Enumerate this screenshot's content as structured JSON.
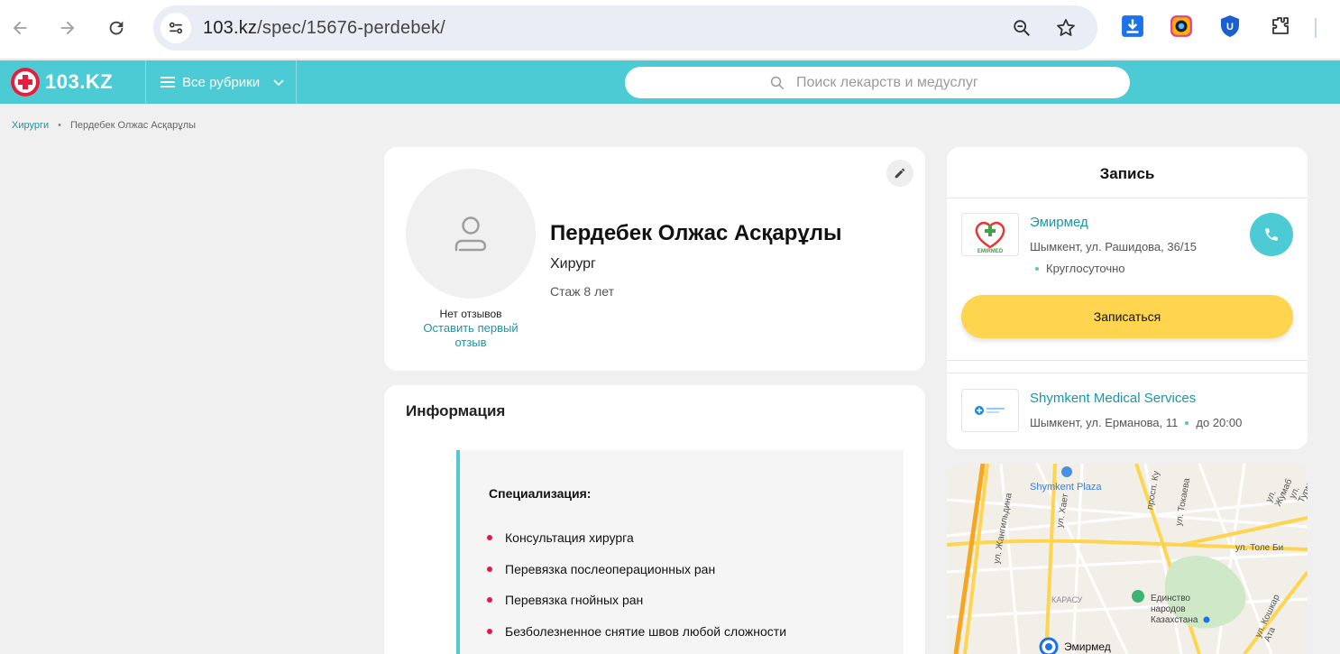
{
  "browser": {
    "url_host": "103.kz",
    "url_path": "/spec/15676-perdebek/"
  },
  "header": {
    "logo_text": "103.KZ",
    "rubrics_label": "Все рубрики",
    "search_placeholder": "Поиск лекарств и медуслуг"
  },
  "breadcrumb": {
    "parent": "Хирурги",
    "separator": "•",
    "current": "Пердебек Олжас Асқарұлы"
  },
  "profile": {
    "name": "Пердебек Олжас Асқарұлы",
    "specialty": "Хирург",
    "experience": "Стаж 8 лет",
    "no_reviews": "Нет отзывов",
    "leave_review": "Оставить первый отзыв"
  },
  "info": {
    "title": "Информация",
    "spec_heading": "Специализация:",
    "items": [
      "Консультация хирурга",
      "Перевязка послеоперационных ран",
      "Перевязка гнойных ран",
      "Безболезненное снятие швов любой сложности"
    ]
  },
  "booking": {
    "title": "Запись",
    "clinics": [
      {
        "name": "Эмирмед",
        "logo_text": "EMIRMED",
        "address": "Шымкент, ул. Рашидова, 36/15",
        "hours": "Круглосуточно"
      },
      {
        "name": "Shymkent Medical Services",
        "address": "Шымкент, ул. Ерманова, 11",
        "hours": "до 20:00"
      }
    ],
    "book_label": "Записаться"
  },
  "map": {
    "labels": {
      "plaza": "Shymkent Plaza",
      "tole_bi": "ул. Толе Би",
      "karasu": "КАРАСУ",
      "unity": "Единство народов Казахстана",
      "marker": "Эмирмед",
      "zhangeldina": "ул. Жангильдина",
      "khaet": "ул. Хает",
      "tokaeva": "ул. Токаева",
      "kazybek": "просп. Ку",
      "koshkar": "ул. Кошкар Ата",
      "zhumab": "ул. Жумаб",
      "turm": "ул. Турм"
    }
  },
  "colors": {
    "brand_teal": "#4dcbd5",
    "link": "#1a97a6",
    "book_button": "#ffd54f",
    "bullet": "#e3174d"
  }
}
